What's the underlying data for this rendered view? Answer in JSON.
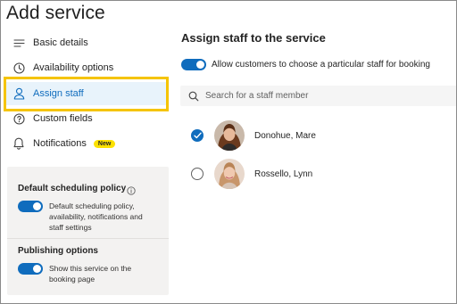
{
  "page": {
    "title": "Add service"
  },
  "nav": {
    "items": [
      {
        "label": "Basic details",
        "icon": "list-icon"
      },
      {
        "label": "Availability options",
        "icon": "clock-icon"
      },
      {
        "label": "Assign staff",
        "icon": "person-icon"
      },
      {
        "label": "Custom fields",
        "icon": "question-circle-icon"
      },
      {
        "label": "Notifications",
        "icon": "bell-icon",
        "badge": "New"
      }
    ],
    "active_index": 2
  },
  "settings": {
    "scheduling": {
      "heading": "Default scheduling policy",
      "description_lines": [
        "Default scheduling policy,",
        "availability, notifications and",
        "staff settings"
      ],
      "toggle_on": true
    },
    "publishing": {
      "heading": "Publishing options",
      "description_lines": [
        "Show this service on the",
        "booking page"
      ],
      "toggle_on": true
    }
  },
  "main": {
    "title": "Assign staff to the service",
    "allow_choice": {
      "label": "Allow customers to choose a particular staff for booking",
      "toggle_on": true
    },
    "search": {
      "placeholder": "Search for a staff member",
      "value": ""
    },
    "staff": [
      {
        "name": "Donohue, Mare",
        "selected": true
      },
      {
        "name": "Rossello, Lynn",
        "selected": false
      }
    ]
  },
  "colors": {
    "accent": "#0f6cbd",
    "highlight_border": "#f5c400",
    "badge_bg": "#fce100",
    "active_nav_bg": "#e8f3fb",
    "panel_bg": "#f3f2f1"
  }
}
